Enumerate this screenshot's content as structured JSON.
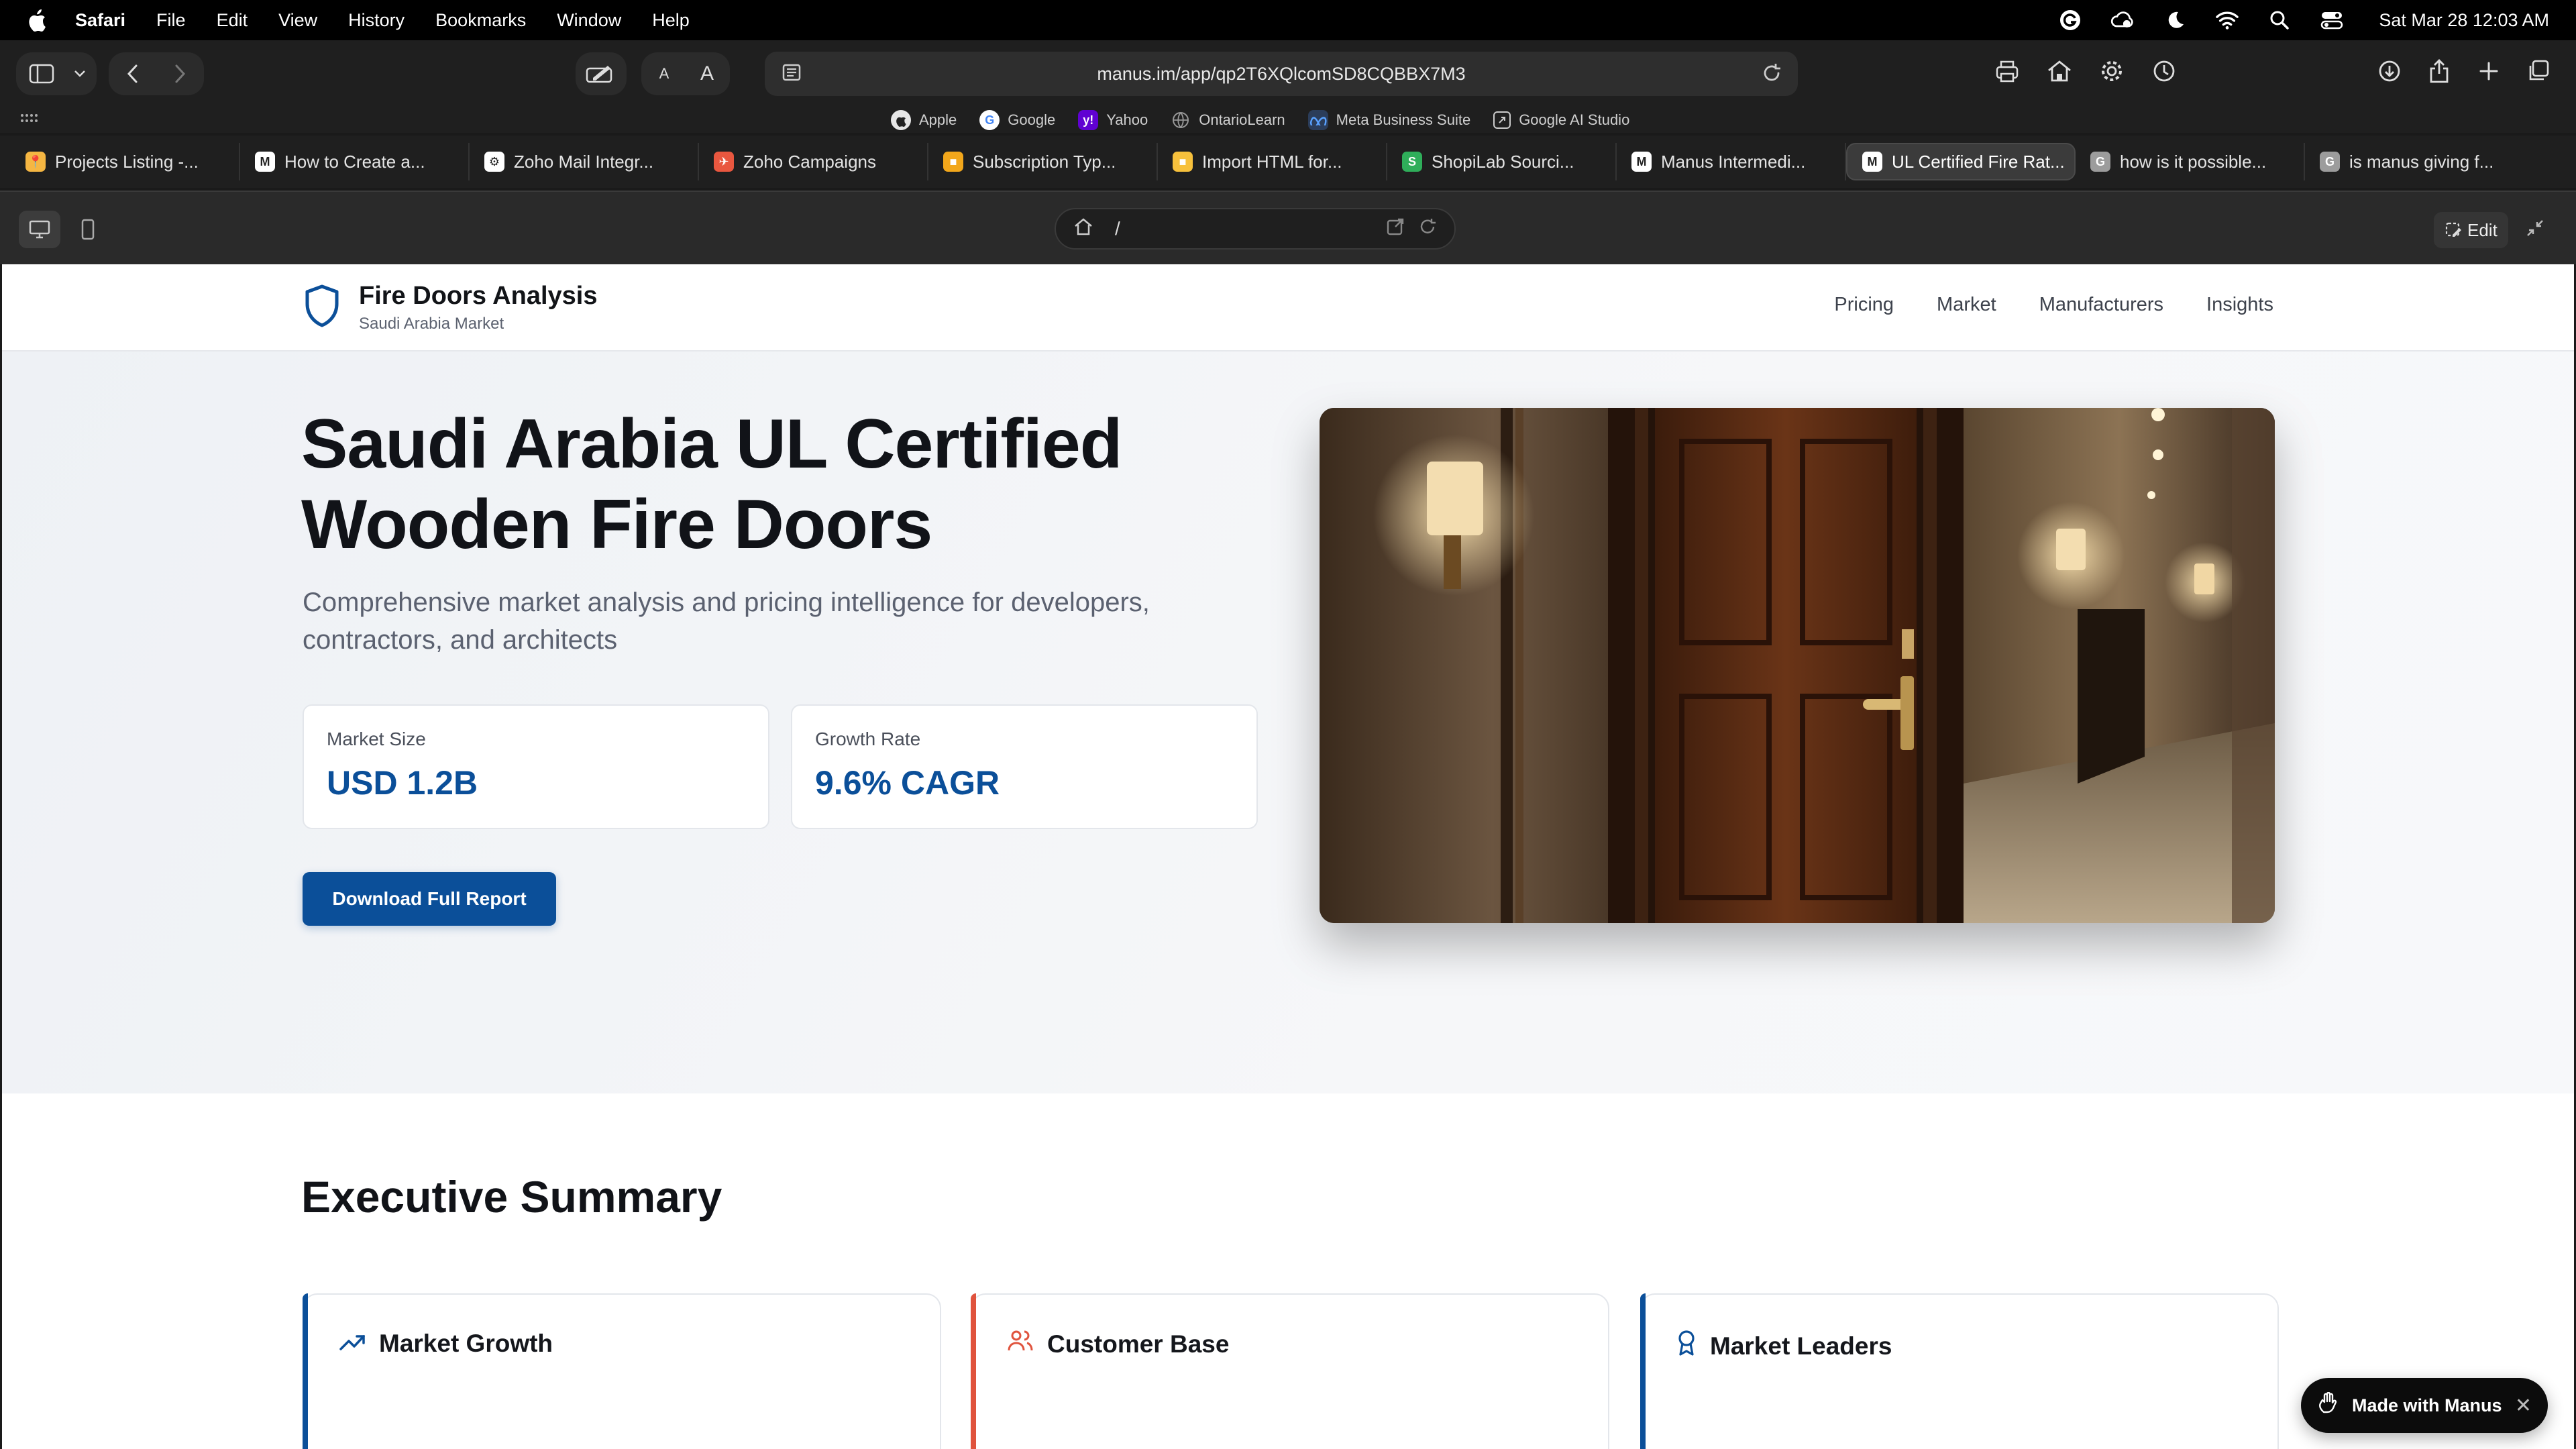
{
  "menubar": {
    "app_name": "Safari",
    "items": [
      "File",
      "Edit",
      "View",
      "History",
      "Bookmarks",
      "Window",
      "Help"
    ],
    "clock": "Sat Mar 28  12:03 AM"
  },
  "toolbar": {
    "url": "manus.im/app/qp2T6XQlcomSD8CQBBX7M3",
    "font_small": "A",
    "font_large": "A"
  },
  "favorites": [
    {
      "label": "Apple",
      "icon": "apple-icon",
      "color": "#e6e6e6"
    },
    {
      "label": "Google",
      "icon": "google-icon",
      "color": "#ffffff"
    },
    {
      "label": "Yahoo",
      "icon": "yahoo-icon",
      "color": "#6001d2"
    },
    {
      "label": "OntarioLearn",
      "icon": "globe-icon",
      "color": "#888888"
    },
    {
      "label": "Meta Business Suite",
      "icon": "meta-icon",
      "color": "#1877f2"
    },
    {
      "label": "Google AI Studio",
      "icon": "ai-studio-icon",
      "color": "#dddddd"
    }
  ],
  "tabs": [
    {
      "label": "Projects Listing -...",
      "color": "#f5b642",
      "glyph": "📍"
    },
    {
      "label": "How to Create a...",
      "color": "#ffffff",
      "glyph": "M"
    },
    {
      "label": "Zoho Mail Integr...",
      "color": "#ffffff",
      "glyph": "⚙"
    },
    {
      "label": "Zoho Campaigns",
      "color": "#e9573f",
      "glyph": "✈"
    },
    {
      "label": "Subscription Typ...",
      "color": "#f2a71b",
      "glyph": "■"
    },
    {
      "label": "Import HTML for...",
      "color": "#f7c13c",
      "glyph": "■"
    },
    {
      "label": "ShopiLab Sourci...",
      "color": "#2fae5a",
      "glyph": "S"
    },
    {
      "label": "Manus Intermedi...",
      "color": "#ffffff",
      "glyph": "M"
    },
    {
      "label": "UL Certified Fire Rat...",
      "color": "#ffffff",
      "glyph": "M"
    },
    {
      "label": "how is it possible...",
      "color": "#9c9c9c",
      "glyph": "G"
    },
    {
      "label": "is manus giving f...",
      "color": "#9c9c9c",
      "glyph": "G"
    }
  ],
  "preview": {
    "path": "/",
    "edit_label": "Edit"
  },
  "site": {
    "brand_title": "Fire Doors Analysis",
    "brand_sub": "Saudi Arabia Market",
    "nav": [
      "Pricing",
      "Market",
      "Manufacturers",
      "Insights"
    ],
    "hero_title_1": "Saudi Arabia UL Certified",
    "hero_title_2": "Wooden Fire Doors",
    "hero_lead": "Comprehensive market analysis and pricing intelligence for developers, contractors, and architects",
    "stats": [
      {
        "label": "Market Size",
        "value": "USD 1.2B"
      },
      {
        "label": "Growth Rate",
        "value": "9.6% CAGR"
      }
    ],
    "cta": "Download Full Report",
    "summary_title": "Executive Summary",
    "cards": [
      {
        "title": "Market Growth",
        "icon": "trending-up-icon",
        "accent": "#0b4f99"
      },
      {
        "title": "Customer Base",
        "icon": "users-icon",
        "accent": "#e0533d"
      },
      {
        "title": "Market Leaders",
        "icon": "award-icon",
        "accent": "#0b4f99"
      }
    ]
  },
  "badge": {
    "label": "Made with Manus"
  }
}
